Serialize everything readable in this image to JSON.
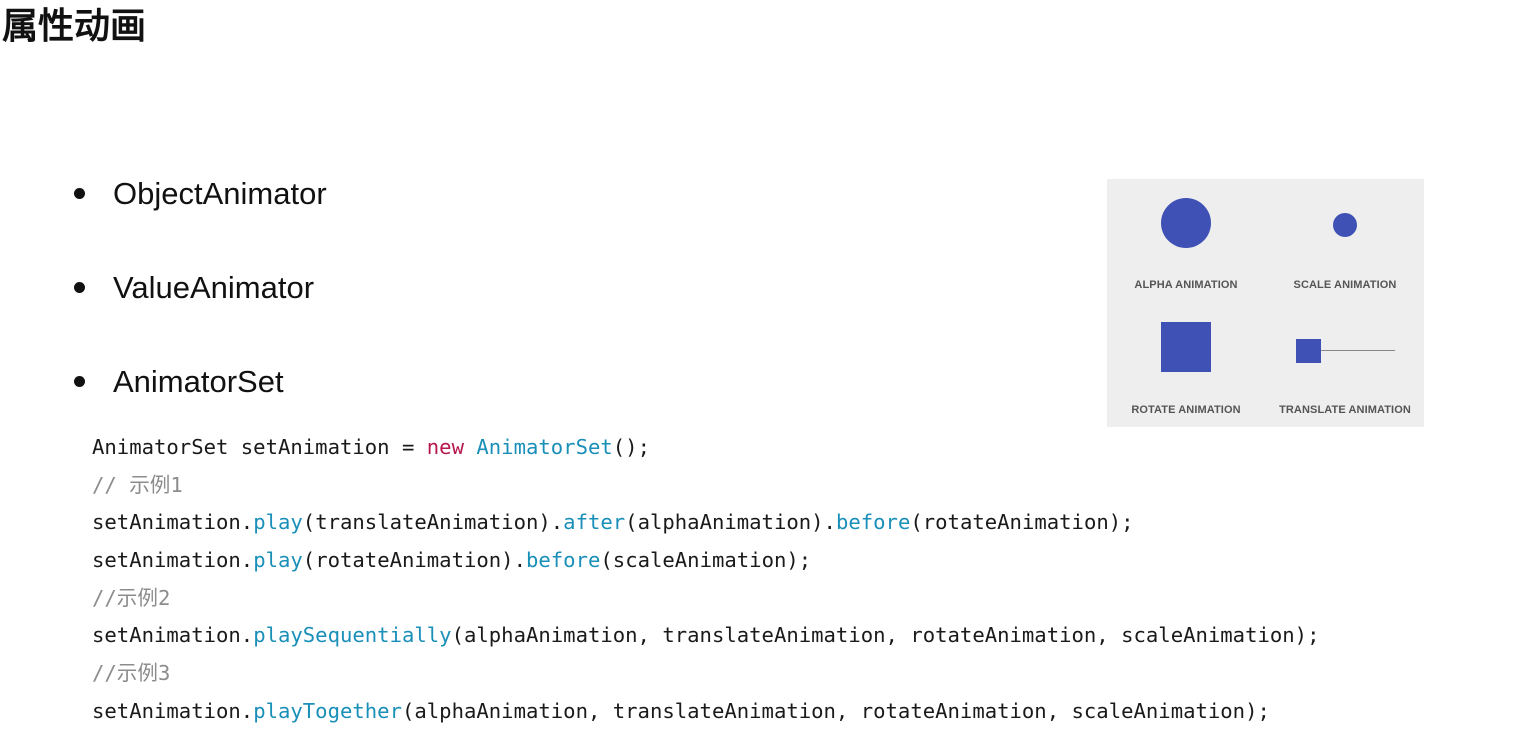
{
  "title": "属性动画",
  "bullets": [
    "ObjectAnimator",
    "ValueAnimator",
    "AnimatorSet"
  ],
  "figure": {
    "shape_color": "#3f51b5",
    "background_color": "#eeeeee",
    "captions": {
      "alpha": "ALPHA ANIMATION",
      "scale": "SCALE ANIMATION",
      "rotate": "ROTATE ANIMATION",
      "translate": "TRANSLATE ANIMATION"
    }
  },
  "code": {
    "colors": {
      "keyword": "#b5174f",
      "method": "#1a8fb8",
      "comment": "#8c8c8c",
      "plain": "#1a1a1a"
    },
    "lines": [
      {
        "kind": "code",
        "parts": [
          {
            "t": "AnimatorSet setAnimation = "
          },
          {
            "t": "new",
            "c": "kw"
          },
          {
            "t": " "
          },
          {
            "t": "AnimatorSet",
            "c": "fn"
          },
          {
            "t": "();"
          }
        ]
      },
      {
        "kind": "comment",
        "parts": [
          {
            "t": "// 示例1",
            "c": "cm"
          }
        ]
      },
      {
        "kind": "code",
        "parts": [
          {
            "t": "setAnimation."
          },
          {
            "t": "play",
            "c": "fn"
          },
          {
            "t": "(translateAnimation)."
          },
          {
            "t": "after",
            "c": "fn"
          },
          {
            "t": "(alphaAnimation)."
          },
          {
            "t": "before",
            "c": "fn"
          },
          {
            "t": "(rotateAnimation);"
          }
        ]
      },
      {
        "kind": "code",
        "parts": [
          {
            "t": "setAnimation."
          },
          {
            "t": "play",
            "c": "fn"
          },
          {
            "t": "(rotateAnimation)."
          },
          {
            "t": "before",
            "c": "fn"
          },
          {
            "t": "(scaleAnimation);"
          }
        ]
      },
      {
        "kind": "comment",
        "parts": [
          {
            "t": "//示例2",
            "c": "cm"
          }
        ]
      },
      {
        "kind": "code",
        "parts": [
          {
            "t": "setAnimation."
          },
          {
            "t": "playSequentially",
            "c": "fn"
          },
          {
            "t": "(alphaAnimation, translateAnimation, rotateAnimation, scaleAnimation);"
          }
        ]
      },
      {
        "kind": "comment",
        "parts": [
          {
            "t": "//示例3",
            "c": "cm"
          }
        ]
      },
      {
        "kind": "code",
        "parts": [
          {
            "t": "setAnimation."
          },
          {
            "t": "playTogether",
            "c": "fn"
          },
          {
            "t": "(alphaAnimation, translateAnimation, rotateAnimation, scaleAnimation);"
          }
        ]
      }
    ]
  }
}
